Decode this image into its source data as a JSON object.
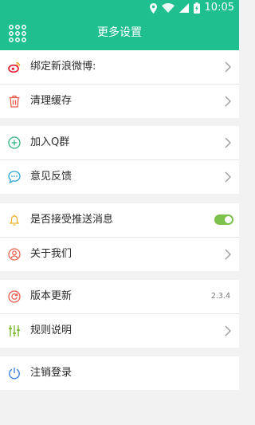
{
  "status_bar": {
    "time": "10:05",
    "icons": [
      "location-icon",
      "wifi-icon",
      "signal-icon",
      "battery-icon"
    ]
  },
  "header": {
    "title": "更多设置",
    "menu_icon": "grid-menu-icon"
  },
  "settings": {
    "weibo": {
      "label": "绑定新浪微博:",
      "icon": "weibo-icon"
    },
    "clear_cache": {
      "label": "清理缓存",
      "icon": "trash-icon"
    },
    "join_qq": {
      "label": "加入Q群",
      "icon": "plus-circle-icon"
    },
    "feedback": {
      "label": "意见反馈",
      "icon": "chat-bubble-icon"
    },
    "push": {
      "label": "是否接受推送消息",
      "icon": "bell-icon",
      "enabled": true
    },
    "about": {
      "label": "关于我们",
      "icon": "user-icon"
    },
    "update": {
      "label": "版本更新",
      "icon": "refresh-icon",
      "version": "2.3.4"
    },
    "rules": {
      "label": "规则说明",
      "icon": "sliders-icon"
    },
    "logout": {
      "label": "注销登录",
      "icon": "power-icon"
    }
  },
  "colors": {
    "header_bg": "#1fbf8f",
    "toggle_on": "#7cc24a",
    "weibo_icon": "#e6162d",
    "trash_icon": "#e65a47",
    "qq_icon": "#31b57f",
    "feedback_icon": "#2ba5d6",
    "bell_icon": "#f2b230",
    "about_icon": "#ec6651",
    "update_icon": "#ea5a4a",
    "rules_icon": "#7cbb2d",
    "logout_icon": "#3d86d9"
  }
}
